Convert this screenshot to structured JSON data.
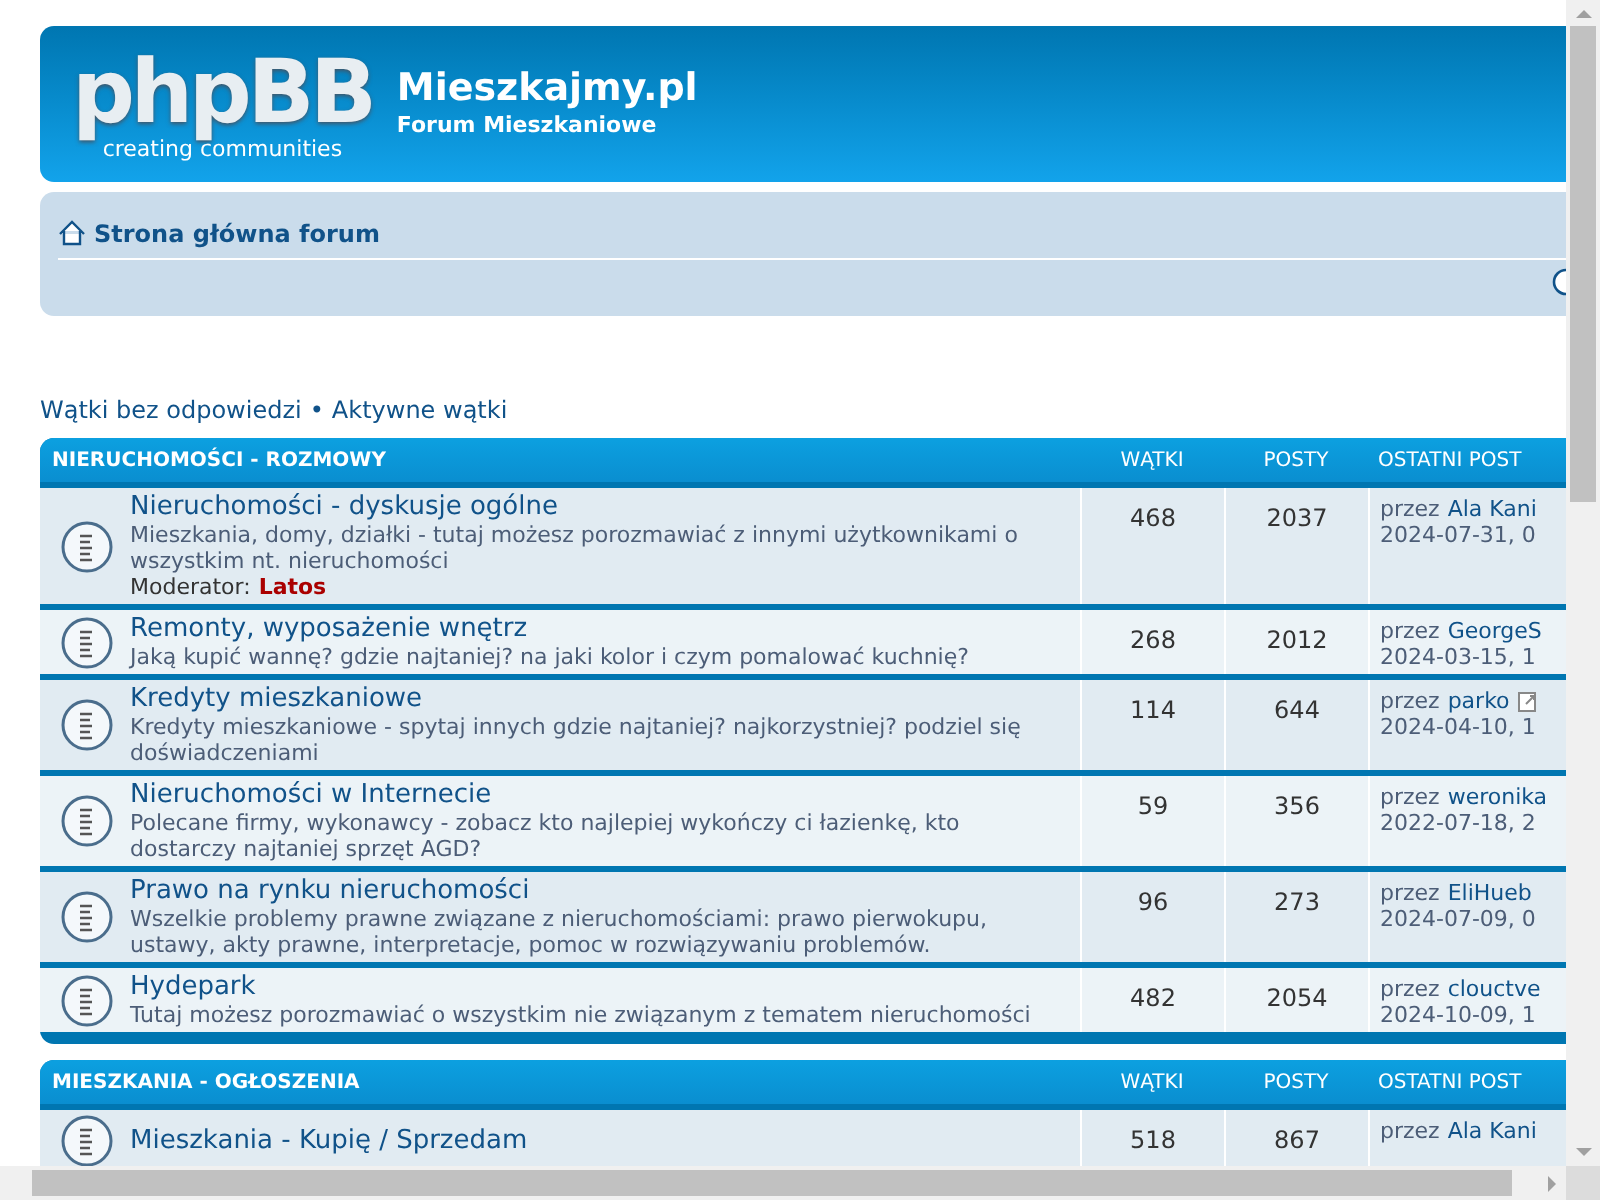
{
  "header": {
    "logo_text": "phpBB",
    "logo_tagline": "creating communities",
    "site_title": "Mieszkajmy.pl",
    "site_description": "Forum Mieszkaniowe"
  },
  "navbar": {
    "breadcrumb": "Strona główna forum"
  },
  "quick_links": [
    "Wątki bez odpowiedzi",
    "•",
    "Aktywne wątki"
  ],
  "categories": [
    {
      "title": "NIERUCHOMOŚCI - ROZMOWY",
      "columns": [
        "WĄTKI",
        "POSTY",
        "OSTATNI POST"
      ],
      "forums": [
        {
          "title": "Nieruchomości - dyskusje ogólne",
          "description": "Mieszkania, domy, działki - tutaj możesz porozmawiać z innymi użytkownikami o wszystkim nt. nieruchomości",
          "moderator_label": "Moderator:",
          "moderator": "Latos",
          "topics": "468",
          "posts": "2037",
          "last_post": {
            "by": "przez",
            "user": "Ala Kani",
            "date": "2024-07-31, 0",
            "latest_icon": false
          }
        },
        {
          "title": "Remonty, wyposażenie wnętrz",
          "description": "Jaką kupić wannę? gdzie najtaniej? na jaki kolor i czym pomalować kuchnię?",
          "topics": "268",
          "posts": "2012",
          "last_post": {
            "by": "przez",
            "user": "GeorgeS",
            "date": "2024-03-15, 1",
            "latest_icon": false
          }
        },
        {
          "title": "Kredyty mieszkaniowe",
          "description": "Kredyty mieszkaniowe - spytaj innych gdzie najtaniej? najkorzystniej? podziel się doświadczeniami",
          "topics": "114",
          "posts": "644",
          "last_post": {
            "by": "przez",
            "user": "parko",
            "date": "2024-04-10, 1",
            "latest_icon": true
          }
        },
        {
          "title": "Nieruchomości w Internecie",
          "description": "Polecane firmy, wykonawcy - zobacz kto najlepiej wykończy ci łazienkę, kto dostarczy najtaniej sprzęt AGD?",
          "topics": "59",
          "posts": "356",
          "last_post": {
            "by": "przez",
            "user": "weronika",
            "date": "2022-07-18, 2",
            "latest_icon": false
          }
        },
        {
          "title": "Prawo na rynku nieruchomości",
          "description": "Wszelkie problemy prawne związane z nieruchomościami: prawo pierwokupu, ustawy, akty prawne, interpretacje, pomoc w rozwiązywaniu problemów.",
          "topics": "96",
          "posts": "273",
          "last_post": {
            "by": "przez",
            "user": "EliHueb",
            "date": "2024-07-09, 0",
            "latest_icon": false
          }
        },
        {
          "title": "Hydepark",
          "description": "Tutaj możesz porozmawiać o wszystkim nie związanym z tematem nieruchomości",
          "topics": "482",
          "posts": "2054",
          "last_post": {
            "by": "przez",
            "user": "clouctve",
            "date": "2024-10-09, 1",
            "latest_icon": false
          }
        }
      ]
    },
    {
      "title": "MIESZKANIA - OGŁOSZENIA",
      "columns": [
        "WĄTKI",
        "POSTY",
        "OSTATNI POST"
      ],
      "forums": [
        {
          "title": "Mieszkania - Kupię / Sprzedam",
          "topics": "518",
          "posts": "867",
          "last_post": {
            "by": "przez",
            "user": "Ala Kani",
            "latest_icon": false
          }
        }
      ]
    }
  ]
}
